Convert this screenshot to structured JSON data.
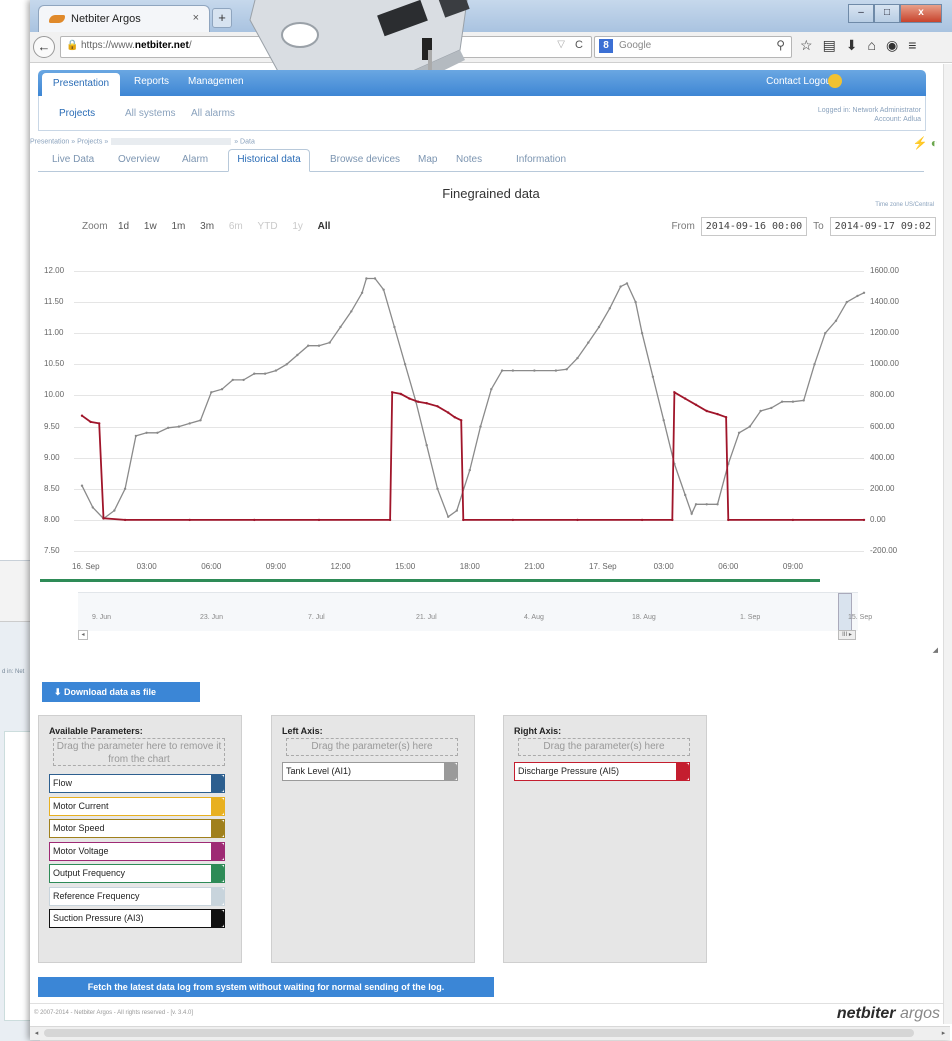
{
  "browser": {
    "tab_title": "Netbiter Argos",
    "tab_close": "×",
    "new_tab": "+",
    "url_prefix": "https://www.",
    "url_domain": "netbiter.net",
    "url_suffix": "/",
    "search_engine": "8",
    "search_placeholder": "Google",
    "window_controls": [
      "–",
      "□",
      "x"
    ]
  },
  "app_nav": {
    "tabs": [
      "Presentation",
      "Reports",
      "Managemen"
    ],
    "top_links": "Contact   Logout"
  },
  "sub_nav": {
    "items": [
      "Projects",
      "All systems",
      "All alarms"
    ],
    "logged_in_line1": "Logged in: Network Administrator",
    "logged_in_line2": "Account: Adlua"
  },
  "breadcrumb": {
    "prefix": "Presentation » Projects »",
    "suffix": "» Data"
  },
  "page_tabs": {
    "live_data": "Live Data",
    "overview": "Overview",
    "alarm": "Alarm",
    "historical": "Historical data",
    "browse": "Browse devices",
    "map": "Map",
    "notes": "Notes",
    "information": "Information"
  },
  "chart_header": {
    "title": "Finegrained data",
    "timezone": "Time zone US/Central",
    "zoom_label": "Zoom",
    "zoom_buttons": [
      "1d",
      "1w",
      "1m",
      "3m",
      "6m",
      "YTD",
      "1y",
      "All"
    ],
    "from_label": "From",
    "from_value": "2014-09-16 00:00",
    "to_label": "To",
    "to_value": "2014-09-17 09:02"
  },
  "chart_data": {
    "type": "line",
    "title": "Finegrained data",
    "x_ticks": [
      "16. Sep",
      "03:00",
      "06:00",
      "09:00",
      "12:00",
      "15:00",
      "18:00",
      "21:00",
      "17. Sep",
      "03:00",
      "06:00",
      "09:00"
    ],
    "y_left_ticks": [
      "12.00",
      "11.50",
      "11.00",
      "10.50",
      "10.00",
      "9.50",
      "9.00",
      "8.50",
      "8.00",
      "7.50"
    ],
    "y_right_ticks": [
      "1600.00",
      "1400.00",
      "1200.00",
      "1000.00",
      "800.00",
      "600.00",
      "400.00",
      "200.00",
      "0.00",
      "-200.00"
    ],
    "ylim_left": [
      7.5,
      12.0
    ],
    "ylim_right": [
      -200,
      1600
    ],
    "xlim_hours": [
      0,
      33.5
    ],
    "grid": true,
    "series": [
      {
        "name": "Tank Level (AI1)",
        "axis": "left",
        "color": "#8a8a8a",
        "points": [
          [
            0,
            8.55
          ],
          [
            0.5,
            8.2
          ],
          [
            1,
            8.02
          ],
          [
            1.5,
            8.15
          ],
          [
            2,
            8.5
          ],
          [
            2.5,
            9.35
          ],
          [
            3,
            9.4
          ],
          [
            3.5,
            9.4
          ],
          [
            4,
            9.48
          ],
          [
            4.5,
            9.5
          ],
          [
            5,
            9.55
          ],
          [
            5.5,
            9.6
          ],
          [
            6,
            10.05
          ],
          [
            6.5,
            10.1
          ],
          [
            7,
            10.25
          ],
          [
            7.5,
            10.25
          ],
          [
            8,
            10.35
          ],
          [
            8.5,
            10.35
          ],
          [
            9,
            10.4
          ],
          [
            9.5,
            10.5
          ],
          [
            10,
            10.65
          ],
          [
            10.5,
            10.8
          ],
          [
            11,
            10.8
          ],
          [
            11.5,
            10.85
          ],
          [
            12,
            11.1
          ],
          [
            12.5,
            11.35
          ],
          [
            13,
            11.65
          ],
          [
            13.2,
            11.88
          ],
          [
            13.6,
            11.88
          ],
          [
            14,
            11.7
          ],
          [
            14.5,
            11.1
          ],
          [
            15,
            10.5
          ],
          [
            15.5,
            9.9
          ],
          [
            16,
            9.2
          ],
          [
            16.5,
            8.5
          ],
          [
            17,
            8.05
          ],
          [
            17.4,
            8.15
          ],
          [
            18,
            8.8
          ],
          [
            18.5,
            9.5
          ],
          [
            19,
            10.1
          ],
          [
            19.5,
            10.4
          ],
          [
            20,
            10.4
          ],
          [
            21,
            10.4
          ],
          [
            22,
            10.4
          ],
          [
            22.5,
            10.42
          ],
          [
            23,
            10.6
          ],
          [
            23.5,
            10.85
          ],
          [
            24,
            11.1
          ],
          [
            24.5,
            11.4
          ],
          [
            25,
            11.75
          ],
          [
            25.3,
            11.8
          ],
          [
            25.7,
            11.5
          ],
          [
            26,
            11.0
          ],
          [
            26.5,
            10.3
          ],
          [
            27,
            9.6
          ],
          [
            27.5,
            8.9
          ],
          [
            28,
            8.4
          ],
          [
            28.3,
            8.1
          ],
          [
            28.5,
            8.25
          ],
          [
            29,
            8.25
          ],
          [
            29.5,
            8.25
          ],
          [
            30,
            8.9
          ],
          [
            30.5,
            9.4
          ],
          [
            31,
            9.5
          ],
          [
            31.5,
            9.75
          ],
          [
            32,
            9.8
          ],
          [
            32.5,
            9.9
          ],
          [
            33,
            9.9
          ],
          [
            33.5,
            9.92
          ],
          [
            34,
            10.5
          ],
          [
            34.5,
            11.0
          ],
          [
            35,
            11.2
          ],
          [
            35.5,
            11.5
          ],
          [
            36,
            11.6
          ],
          [
            36.3,
            11.65
          ]
        ]
      },
      {
        "name": "Discharge Pressure (AI5)",
        "axis": "right",
        "color": "#a0152a",
        "points": [
          [
            0,
            670
          ],
          [
            0.4,
            630
          ],
          [
            0.8,
            620
          ],
          [
            1,
            10
          ],
          [
            2,
            0
          ],
          [
            5,
            0
          ],
          [
            8,
            0
          ],
          [
            11,
            0
          ],
          [
            14.3,
            0
          ],
          [
            14.4,
            820
          ],
          [
            14.8,
            810
          ],
          [
            15.2,
            780
          ],
          [
            15.6,
            760
          ],
          [
            16,
            750
          ],
          [
            16.5,
            730
          ],
          [
            17,
            690
          ],
          [
            17.3,
            660
          ],
          [
            17.6,
            640
          ],
          [
            17.7,
            0
          ],
          [
            20,
            0
          ],
          [
            23,
            0
          ],
          [
            26,
            0
          ],
          [
            27.4,
            0
          ],
          [
            27.5,
            820
          ],
          [
            28,
            780
          ],
          [
            28.5,
            740
          ],
          [
            29,
            700
          ],
          [
            29.5,
            680
          ],
          [
            29.9,
            660
          ],
          [
            30,
            0
          ],
          [
            33,
            0
          ],
          [
            36.3,
            0
          ]
        ]
      }
    ]
  },
  "navigator": {
    "labels": [
      "9. Jun",
      "23. Jun",
      "7. Jul",
      "21. Jul",
      "4. Aug",
      "18. Aug",
      "1. Sep",
      "15. Sep"
    ],
    "scroll_left": "◂",
    "scroll_right": "III ▸",
    "resize": "◢"
  },
  "download_button": "⬇  Download data as file",
  "available": {
    "title": "Available Parameters:",
    "dropzone": "Drag the parameter here to remove it from the chart",
    "params": [
      {
        "label": "Flow",
        "color": "#2d5f8f",
        "border": "#2d5f8f"
      },
      {
        "label": "Motor Current",
        "color": "#e8b020",
        "border": "#e8b020"
      },
      {
        "label": "Motor Speed",
        "color": "#a0801c",
        "border": "#a0801c"
      },
      {
        "label": "Motor Voltage",
        "color": "#9e2a74",
        "border": "#9e2a74"
      },
      {
        "label": "Output Frequency",
        "color": "#2e8b57",
        "border": "#2e8b57"
      },
      {
        "label": "Reference Frequency",
        "color": "#c8d4dc",
        "border": "#c8d4dc"
      },
      {
        "label": "Suction Pressure (AI3)",
        "color": "#111111",
        "border": "#111111"
      }
    ]
  },
  "left_axis": {
    "title": "Left Axis:",
    "dropzone": "Drag the parameter(s) here",
    "params": [
      {
        "label": "Tank Level (AI1)",
        "color": "#9a9a9a",
        "border": "#9a9a9a"
      }
    ]
  },
  "right_axis": {
    "title": "Right Axis:",
    "dropzone": "Drag the parameter(s) here",
    "params": [
      {
        "label": "Discharge Pressure (AI5)",
        "color": "#c41e2f",
        "border": "#c41e2f"
      }
    ]
  },
  "fetch_button": "Fetch the latest data log from system without waiting for normal sending of the log.",
  "footer": {
    "copyright": "© 2007-2014 - Netbiter Argos - All rights reserved - [v. 3.4.0]",
    "brand_main": "netbiter",
    "brand_sub": " argos"
  }
}
